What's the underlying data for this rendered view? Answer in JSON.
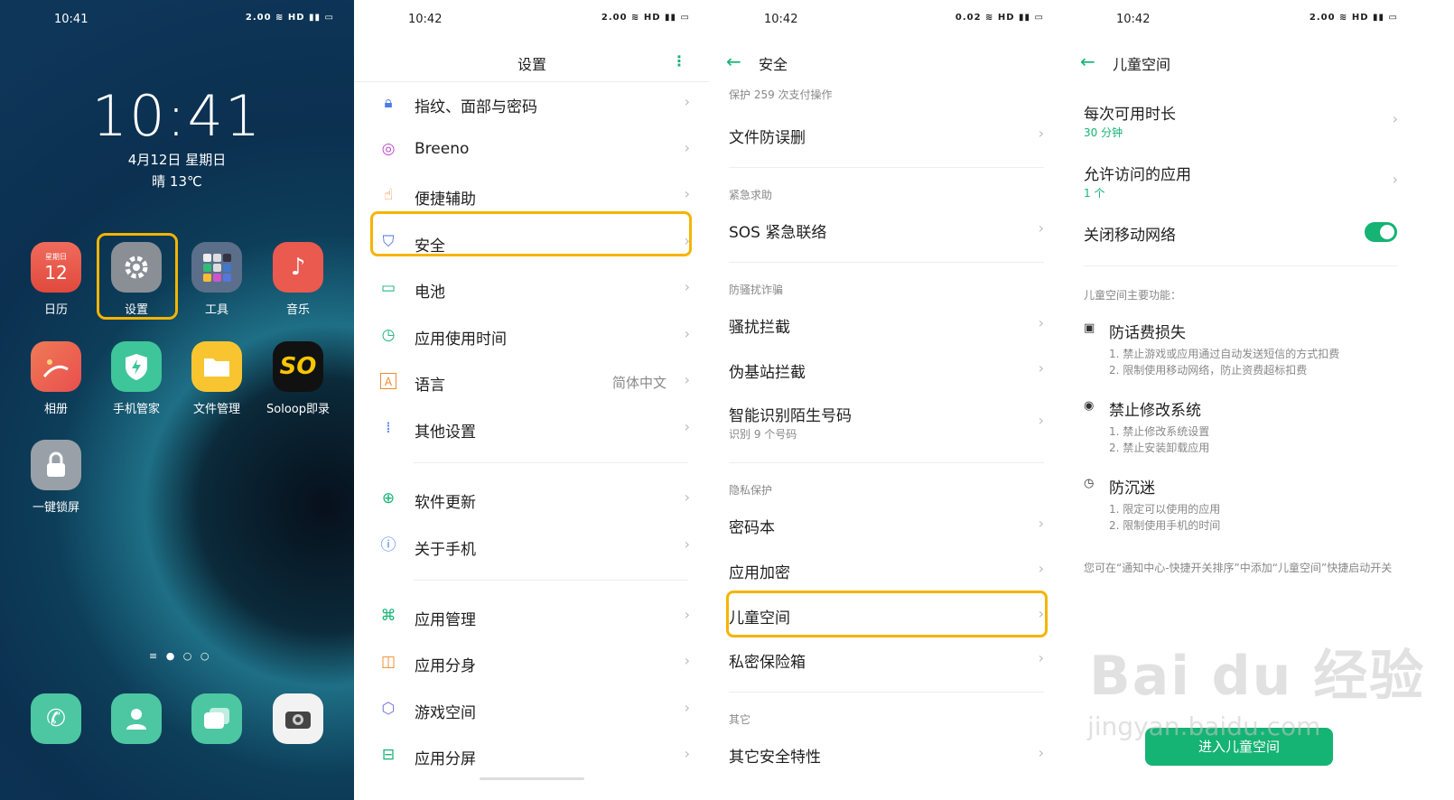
{
  "panel1": {
    "status_time": "10:41",
    "status_icons": "2.00 ≋ HD ▮▮ ▭",
    "clock": "10:41",
    "date": "4月12日 星期日",
    "weather": "晴 13℃",
    "apps": [
      {
        "label": "日历",
        "weekday": "星期日",
        "day": "12"
      },
      {
        "label": "设置"
      },
      {
        "label": "工具"
      },
      {
        "label": "音乐"
      },
      {
        "label": "相册"
      },
      {
        "label": "手机管家"
      },
      {
        "label": "文件管理"
      },
      {
        "label": "Soloop即录",
        "glyph": "SO"
      },
      {
        "label": "一键锁屏"
      }
    ]
  },
  "panel2": {
    "status_time": "10:42",
    "status_icons": "2.00 ≋ HD ▮▮ ▭",
    "title": "设置",
    "items": [
      {
        "label": "指纹、面部与密码"
      },
      {
        "label": "Breeno"
      },
      {
        "label": "便捷辅助"
      },
      {
        "label": "安全"
      },
      {
        "label": "电池"
      },
      {
        "label": "应用使用时间"
      },
      {
        "label": "语言",
        "value": "简体中文"
      },
      {
        "label": "其他设置"
      },
      {
        "label": "软件更新"
      },
      {
        "label": "关于手机"
      },
      {
        "label": "应用管理"
      },
      {
        "label": "应用分身"
      },
      {
        "label": "游戏空间"
      },
      {
        "label": "应用分屏"
      }
    ]
  },
  "panel3": {
    "status_time": "10:42",
    "status_icons": "0.02 ≋ HD ▮▮ ▭",
    "title": "安全",
    "protect_text": "保护 259 次支付操作",
    "file_protect": "文件防误删",
    "sec_emergency": "紧急求助",
    "sos": "SOS 紧急联络",
    "sec_fraud": "防骚扰诈骗",
    "harass": "骚扰拦截",
    "fake_station": "伪基站拦截",
    "smart_id": "智能识别陌生号码",
    "smart_id_sub": "识别 9 个号码",
    "sec_privacy": "隐私保护",
    "password_book": "密码本",
    "app_lock": "应用加密",
    "kids_space": "儿童空间",
    "private_safe": "私密保险箱",
    "sec_other": "其它",
    "other_security": "其它安全特性"
  },
  "panel4": {
    "status_time": "10:42",
    "status_icons": "2.00 ≋ HD ▮▮ ▭",
    "title": "儿童空间",
    "duration_label": "每次可用时长",
    "duration_value": "30 分钟",
    "apps_label": "允许访问的应用",
    "apps_value": "1 个",
    "mobile_label": "关闭移动网络",
    "mobile_on": true,
    "features_title": "儿童空间主要功能：",
    "features": [
      {
        "title": "防话费损失",
        "lines": [
          "1. 禁止游戏或应用通过自动发送短信的方式扣费",
          "2. 限制使用移动网络，防止资费超标扣费"
        ]
      },
      {
        "title": "禁止修改系统",
        "lines": [
          "1. 禁止修改系统设置",
          "2. 禁止安装卸载应用"
        ]
      },
      {
        "title": "防沉迷",
        "lines": [
          "1. 限定可以使用的应用",
          "2. 限制使用手机的时间"
        ]
      }
    ],
    "note": "您可在“通知中心-快捷开关排序”中添加“儿童空间”快捷启动开关",
    "enter_button": "进入儿童空间",
    "watermark_logo": "Bai du 经验",
    "watermark_url": "jingyan.baidu.com"
  },
  "colors": {
    "accent": "#15b374",
    "highlight": "#f5b400"
  }
}
